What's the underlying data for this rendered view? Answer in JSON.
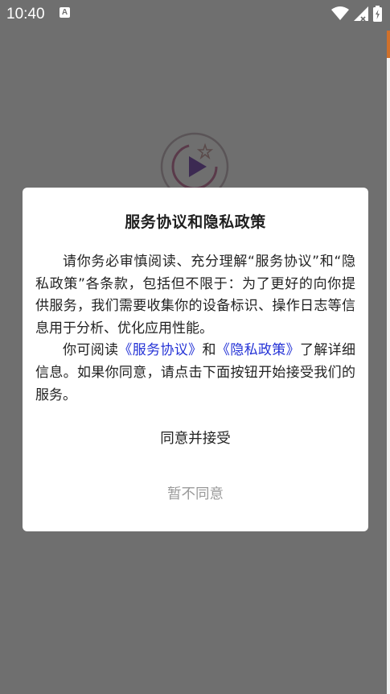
{
  "status_bar": {
    "time": "10:40",
    "notification_icon": "a-letter-icon",
    "icons": [
      "wifi-icon",
      "signal-icon",
      "battery-icon"
    ]
  },
  "dialog": {
    "title": "服务协议和隐私政策",
    "paragraph1": "请你务必审慎阅读、充分理解“服务协议”和“隐私政策”各条款，包括但不限于：为了更好的向你提供服务，我们需要收集你的设备标识、操作日志等信息用于分析、优化应用性能。",
    "paragraph2_prefix": "你可阅读",
    "service_agreement_link": "《服务协议》",
    "and_text": "和",
    "privacy_policy_link": "《隐私政策》",
    "paragraph2_suffix": "了解详细信息。如果你同意，请点击下面按钮开始接受我们的服务。",
    "agree_button": "同意并接受",
    "decline_button": "暂不同意"
  },
  "colors": {
    "overlay": "#6f6f6f",
    "link": "#2432d6",
    "accent": "#d0702a",
    "disabled_text": "#9a9a9a"
  }
}
